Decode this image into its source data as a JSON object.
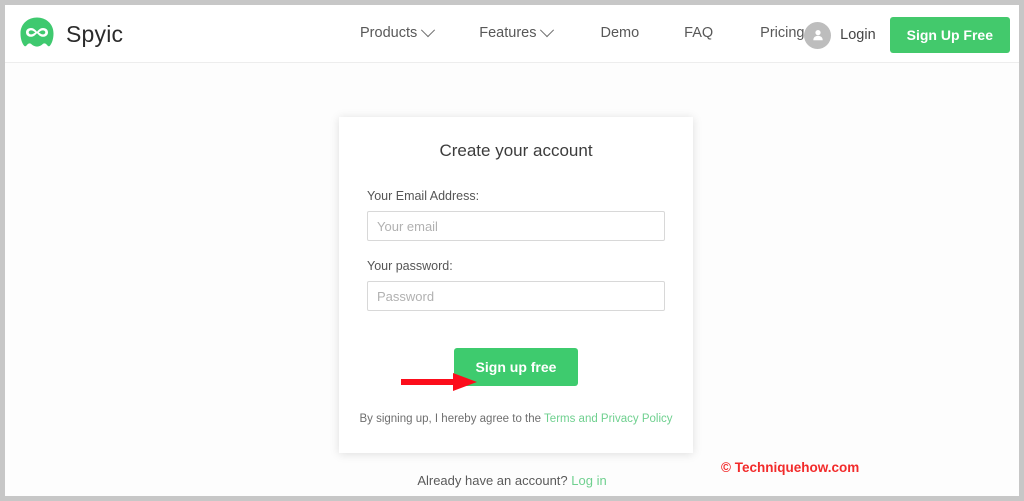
{
  "header": {
    "brand": {
      "logo_icon": "infinity-logo-icon",
      "name": "Spyic",
      "logo_color": "#3fc96f"
    },
    "nav": [
      {
        "label": "Products",
        "has_dropdown": true,
        "icon": "chevron-down-icon"
      },
      {
        "label": "Features",
        "has_dropdown": true,
        "icon": "chevron-down-icon"
      },
      {
        "label": "Demo",
        "has_dropdown": false,
        "icon": ""
      },
      {
        "label": "FAQ",
        "has_dropdown": false,
        "icon": ""
      },
      {
        "label": "Pricing",
        "has_dropdown": false,
        "icon": ""
      }
    ],
    "login": {
      "icon": "user-avatar-icon",
      "label": "Login"
    },
    "signup_button": {
      "label": "Sign Up Free",
      "color": "#43c96c"
    }
  },
  "signup_card": {
    "title": "Create your account",
    "email_field": {
      "label": "Your Email Address:",
      "placeholder": "Your email",
      "value": ""
    },
    "password_field": {
      "label": "Your password:",
      "placeholder": "Password",
      "value": ""
    },
    "submit_button": {
      "label": "Sign up free",
      "color": "#3ecb6e"
    },
    "terms": {
      "text": "By signing up, I hereby agree to the",
      "link_label": "Terms and Privacy Policy",
      "link_color": "#6fd08f"
    }
  },
  "footer": {
    "existing_account_text": "Already have an account?",
    "login_link_label": "Log in"
  },
  "annotations": {
    "arrow": {
      "icon": "red-arrow-right-icon",
      "color": "#fc0d1b",
      "points_to": "Sign up free"
    },
    "watermark": {
      "text": "© Techniquehow.com",
      "color": "#f22b2b"
    }
  }
}
